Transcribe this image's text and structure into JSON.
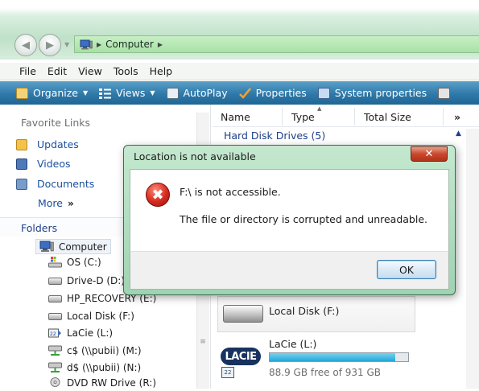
{
  "window": {
    "address_path": "Computer"
  },
  "menu": [
    "File",
    "Edit",
    "View",
    "Tools",
    "Help"
  ],
  "toolbar": {
    "organize": "Organize",
    "views": "Views",
    "autoplay": "AutoPlay",
    "properties": "Properties",
    "system_properties": "System properties"
  },
  "nav": {
    "favorite_links_header": "Favorite Links",
    "favorites": [
      "Updates",
      "Videos",
      "Documents"
    ],
    "more": "More",
    "folders_header": "Folders",
    "tree": [
      "Computer",
      "OS (C:)",
      "Drive-D (D:)",
      "HP_RECOVERY (E:)",
      "Local Disk (F:)",
      "LaCie (L:)",
      "c$ (\\\\pubii) (M:)",
      "d$ (\\\\pubii) (N:)",
      "DVD RW Drive (R:)"
    ]
  },
  "content": {
    "columns": [
      "Name",
      "Type",
      "Total Size"
    ],
    "group_header": "Hard Disk Drives (5)",
    "tiles": [
      {
        "name": "Local Disk (F:)"
      },
      {
        "name": "LaCie (L:)",
        "free_text": "88.9 GB free of 931 GB",
        "used_fraction": 0.905
      }
    ],
    "lacie_logo": "LACIE"
  },
  "dialog": {
    "title": "Location is not available",
    "message": "F:\\ is not accessible.",
    "detail": "The file or directory is corrupted and unreadable.",
    "ok_label": "OK"
  },
  "colors": {
    "toolbar": "#2f79a9",
    "link": "#1a4fa0",
    "close_button": "#c9472f",
    "error_icon": "#d42b1e",
    "progress": "#26a6d6"
  }
}
